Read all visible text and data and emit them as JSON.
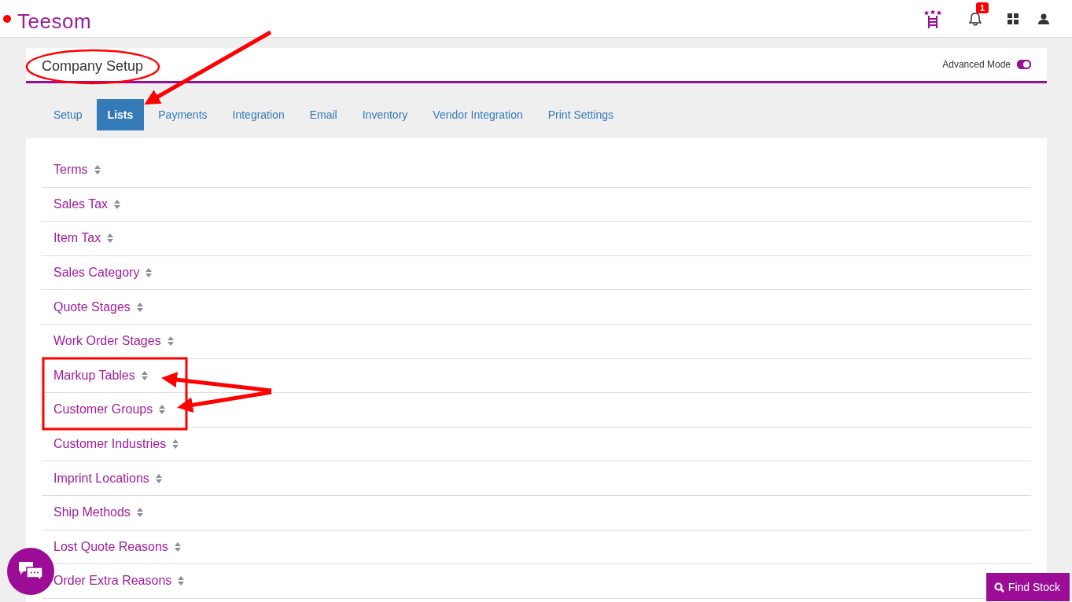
{
  "header": {
    "logo": "Teesom",
    "notifications": {
      "count": "1"
    }
  },
  "page": {
    "title": "Company Setup",
    "advanced_mode": {
      "label": "Advanced Mode",
      "on": true
    }
  },
  "tabs": [
    {
      "label": "Setup",
      "selected": false
    },
    {
      "label": "Lists",
      "selected": true
    },
    {
      "label": "Payments",
      "selected": false
    },
    {
      "label": "Integration",
      "selected": false
    },
    {
      "label": "Email",
      "selected": false
    },
    {
      "label": "Inventory",
      "selected": false
    },
    {
      "label": "Vendor Integration",
      "selected": false
    },
    {
      "label": "Print Settings",
      "selected": false
    }
  ],
  "lists": [
    {
      "label": "Terms"
    },
    {
      "label": "Sales Tax"
    },
    {
      "label": "Item Tax"
    },
    {
      "label": "Sales Category"
    },
    {
      "label": "Quote Stages"
    },
    {
      "label": "Work Order Stages"
    },
    {
      "label": "Markup Tables"
    },
    {
      "label": "Customer Groups"
    },
    {
      "label": "Customer Industries"
    },
    {
      "label": "Imprint Locations"
    },
    {
      "label": "Ship Methods"
    },
    {
      "label": "Lost Quote Reasons"
    },
    {
      "label": "Order Extra Reasons"
    }
  ],
  "find_stock": {
    "label": "Find Stock"
  }
}
